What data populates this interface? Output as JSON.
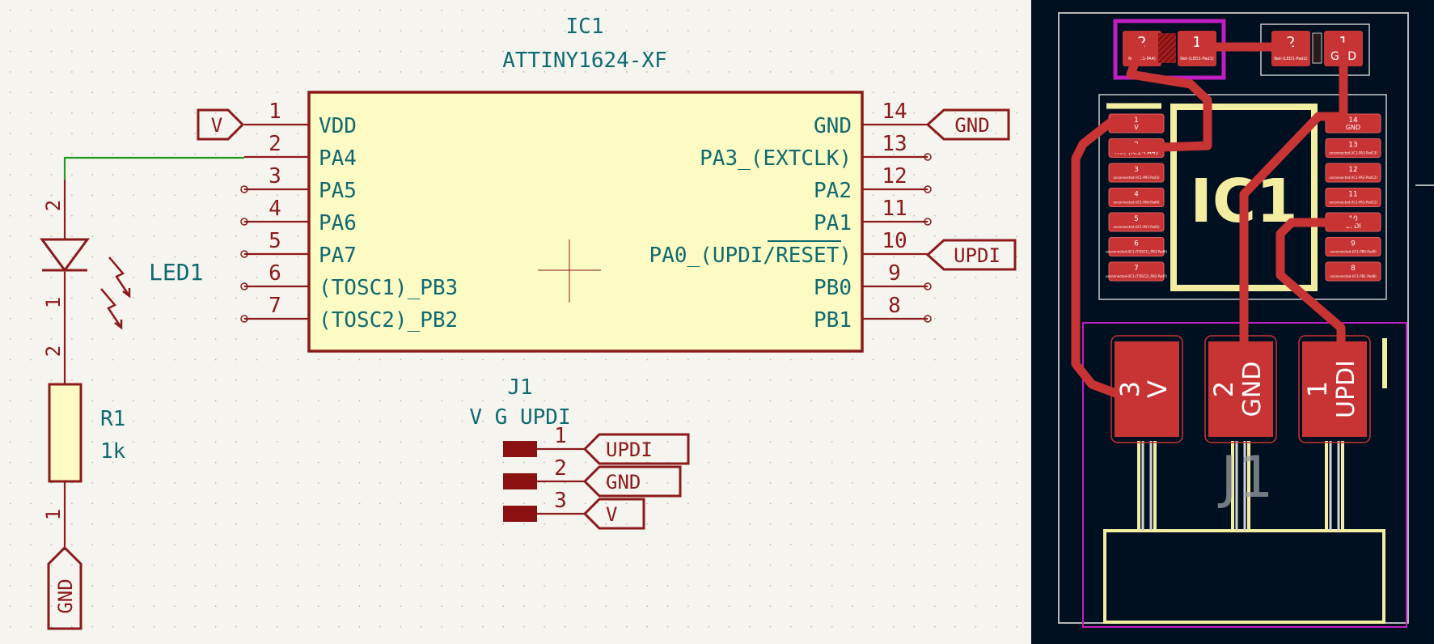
{
  "schematic": {
    "ic": {
      "ref": "IC1",
      "value": "ATTINY1624-XF",
      "left_pins": [
        {
          "num": "1",
          "name": "VDD"
        },
        {
          "num": "2",
          "name": "PA4"
        },
        {
          "num": "3",
          "name": "PA5"
        },
        {
          "num": "4",
          "name": "PA6"
        },
        {
          "num": "5",
          "name": "PA7"
        },
        {
          "num": "6",
          "name": "(TOSC1)_PB3"
        },
        {
          "num": "7",
          "name": "(TOSC2)_PB2"
        }
      ],
      "right_pins": [
        {
          "num": "14",
          "name": "GND"
        },
        {
          "num": "13",
          "name": "PA3_(EXTCLK)"
        },
        {
          "num": "12",
          "name": "PA2"
        },
        {
          "num": "11",
          "name": "PA1"
        },
        {
          "num": "10",
          "name": "PA0_(UPDI/RESET)"
        },
        {
          "num": "9",
          "name": "PB0"
        },
        {
          "num": "8",
          "name": "PB1"
        }
      ],
      "net_labels": {
        "vdd": "V",
        "gnd": "GND",
        "updi": "UPDI"
      }
    },
    "led": {
      "ref": "LED1",
      "pin_top": "2",
      "pin_bottom": "1"
    },
    "resistor": {
      "ref": "R1",
      "value": "1k",
      "pin_top": "2",
      "pin_bottom": "1"
    },
    "gnd_label": "GND",
    "connector": {
      "ref": "J1",
      "value": "V G UPDI",
      "pins": [
        {
          "num": "1",
          "net": "UPDI"
        },
        {
          "num": "2",
          "net": "GND"
        },
        {
          "num": "3",
          "net": "V"
        }
      ]
    }
  },
  "pcb": {
    "r1_pads": [
      {
        "num": "2",
        "net": "Net-(IC1-PA4)"
      },
      {
        "num": "1",
        "net": "Net-(LED1-Pad1)"
      }
    ],
    "led_pads": [
      {
        "num": "2",
        "net": "Net-(LED1-Pad2)"
      },
      {
        "num": "1",
        "net": "GND"
      }
    ],
    "ic_left_pads": [
      {
        "num": "1",
        "net": "V"
      },
      {
        "num": "2",
        "net": "Net-(IC1-PA4)"
      },
      {
        "num": "3",
        "net": "unconnected-(IC1-PA5-Pad3)"
      },
      {
        "num": "4",
        "net": "unconnected-(IC1-PA6-Pad4)"
      },
      {
        "num": "5",
        "net": "unconnected-(IC1-PA7-Pad5)"
      },
      {
        "num": "6",
        "net": "unconnected-(IC1-(TOSC1)_PB3-Pad6)"
      },
      {
        "num": "7",
        "net": "unconnected-(IC1-(TOSC2)_PB2-Pad7)"
      }
    ],
    "ic_right_pads": [
      {
        "num": "14",
        "net": "GND"
      },
      {
        "num": "13",
        "net": "unconnected-(IC1-PA3-Pad13)"
      },
      {
        "num": "12",
        "net": "unconnected-(IC1-PA2-Pad12)"
      },
      {
        "num": "11",
        "net": "unconnected-(IC1-PA1-Pad11)"
      },
      {
        "num": "10",
        "net": "UPDI"
      },
      {
        "num": "9",
        "net": "unconnected-(IC1-PB0-Pad9)"
      },
      {
        "num": "8",
        "net": "unconnected-(IC1-PB1-Pad8)"
      }
    ],
    "ic_silk": "IC1",
    "j1_pads": [
      {
        "num": "3",
        "net": "V"
      },
      {
        "num": "2",
        "net": "GND"
      },
      {
        "num": "1",
        "net": "UPDI"
      }
    ],
    "j1_silk": "J1"
  },
  "colors": {
    "schematic_bg": "#f5f4ef",
    "wire": "#1e9a1e",
    "symbol": "#8b1a1a",
    "symbol_fill": "#fdfbc4",
    "ref_text": "#0f6a70",
    "pcb_bg": "#001020",
    "copper": "#c83434",
    "silk": "#f2eda1",
    "courtyard": "#c01ec0"
  }
}
